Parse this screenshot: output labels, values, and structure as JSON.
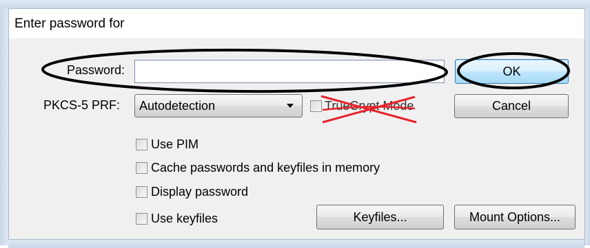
{
  "dialog": {
    "title": "Enter password for"
  },
  "password": {
    "label": "Password:",
    "value": ""
  },
  "prf": {
    "label": "PKCS-5 PRF:",
    "selected": "Autodetection"
  },
  "truecrypt_mode": {
    "label": "TrueCrypt Mode",
    "checked": false
  },
  "buttons": {
    "ok": "OK",
    "cancel": "Cancel",
    "keyfiles": "Keyfiles...",
    "mount_options": "Mount Options..."
  },
  "options": [
    {
      "label": "Use PIM",
      "checked": false
    },
    {
      "label": "Cache passwords and keyfiles in memory",
      "checked": false
    },
    {
      "label": "Display password",
      "checked": false
    },
    {
      "label": "Use keyfiles",
      "checked": false
    }
  ],
  "annotations": {
    "circle_color": "#000000",
    "cross_color": "#e8222a"
  }
}
